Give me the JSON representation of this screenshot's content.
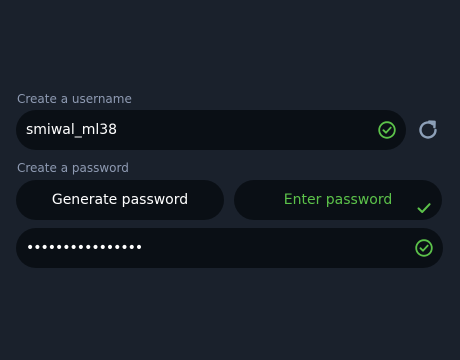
{
  "username": {
    "label": "Create a username",
    "value": "smiwal_ml38",
    "valid_icon": "check-circle-icon",
    "refresh_icon": "refresh-icon"
  },
  "password": {
    "label": "Create a password",
    "generate_label": "Generate password",
    "enter_label": "Enter password",
    "enter_selected": true,
    "masked_value": "••••••••••••••••",
    "valid_icon": "check-circle-icon"
  },
  "colors": {
    "background": "#1a212c",
    "field": "#0a0f15",
    "label": "#8e9ab2",
    "accent_green": "#5cc24a",
    "refresh": "#8da0b8"
  }
}
